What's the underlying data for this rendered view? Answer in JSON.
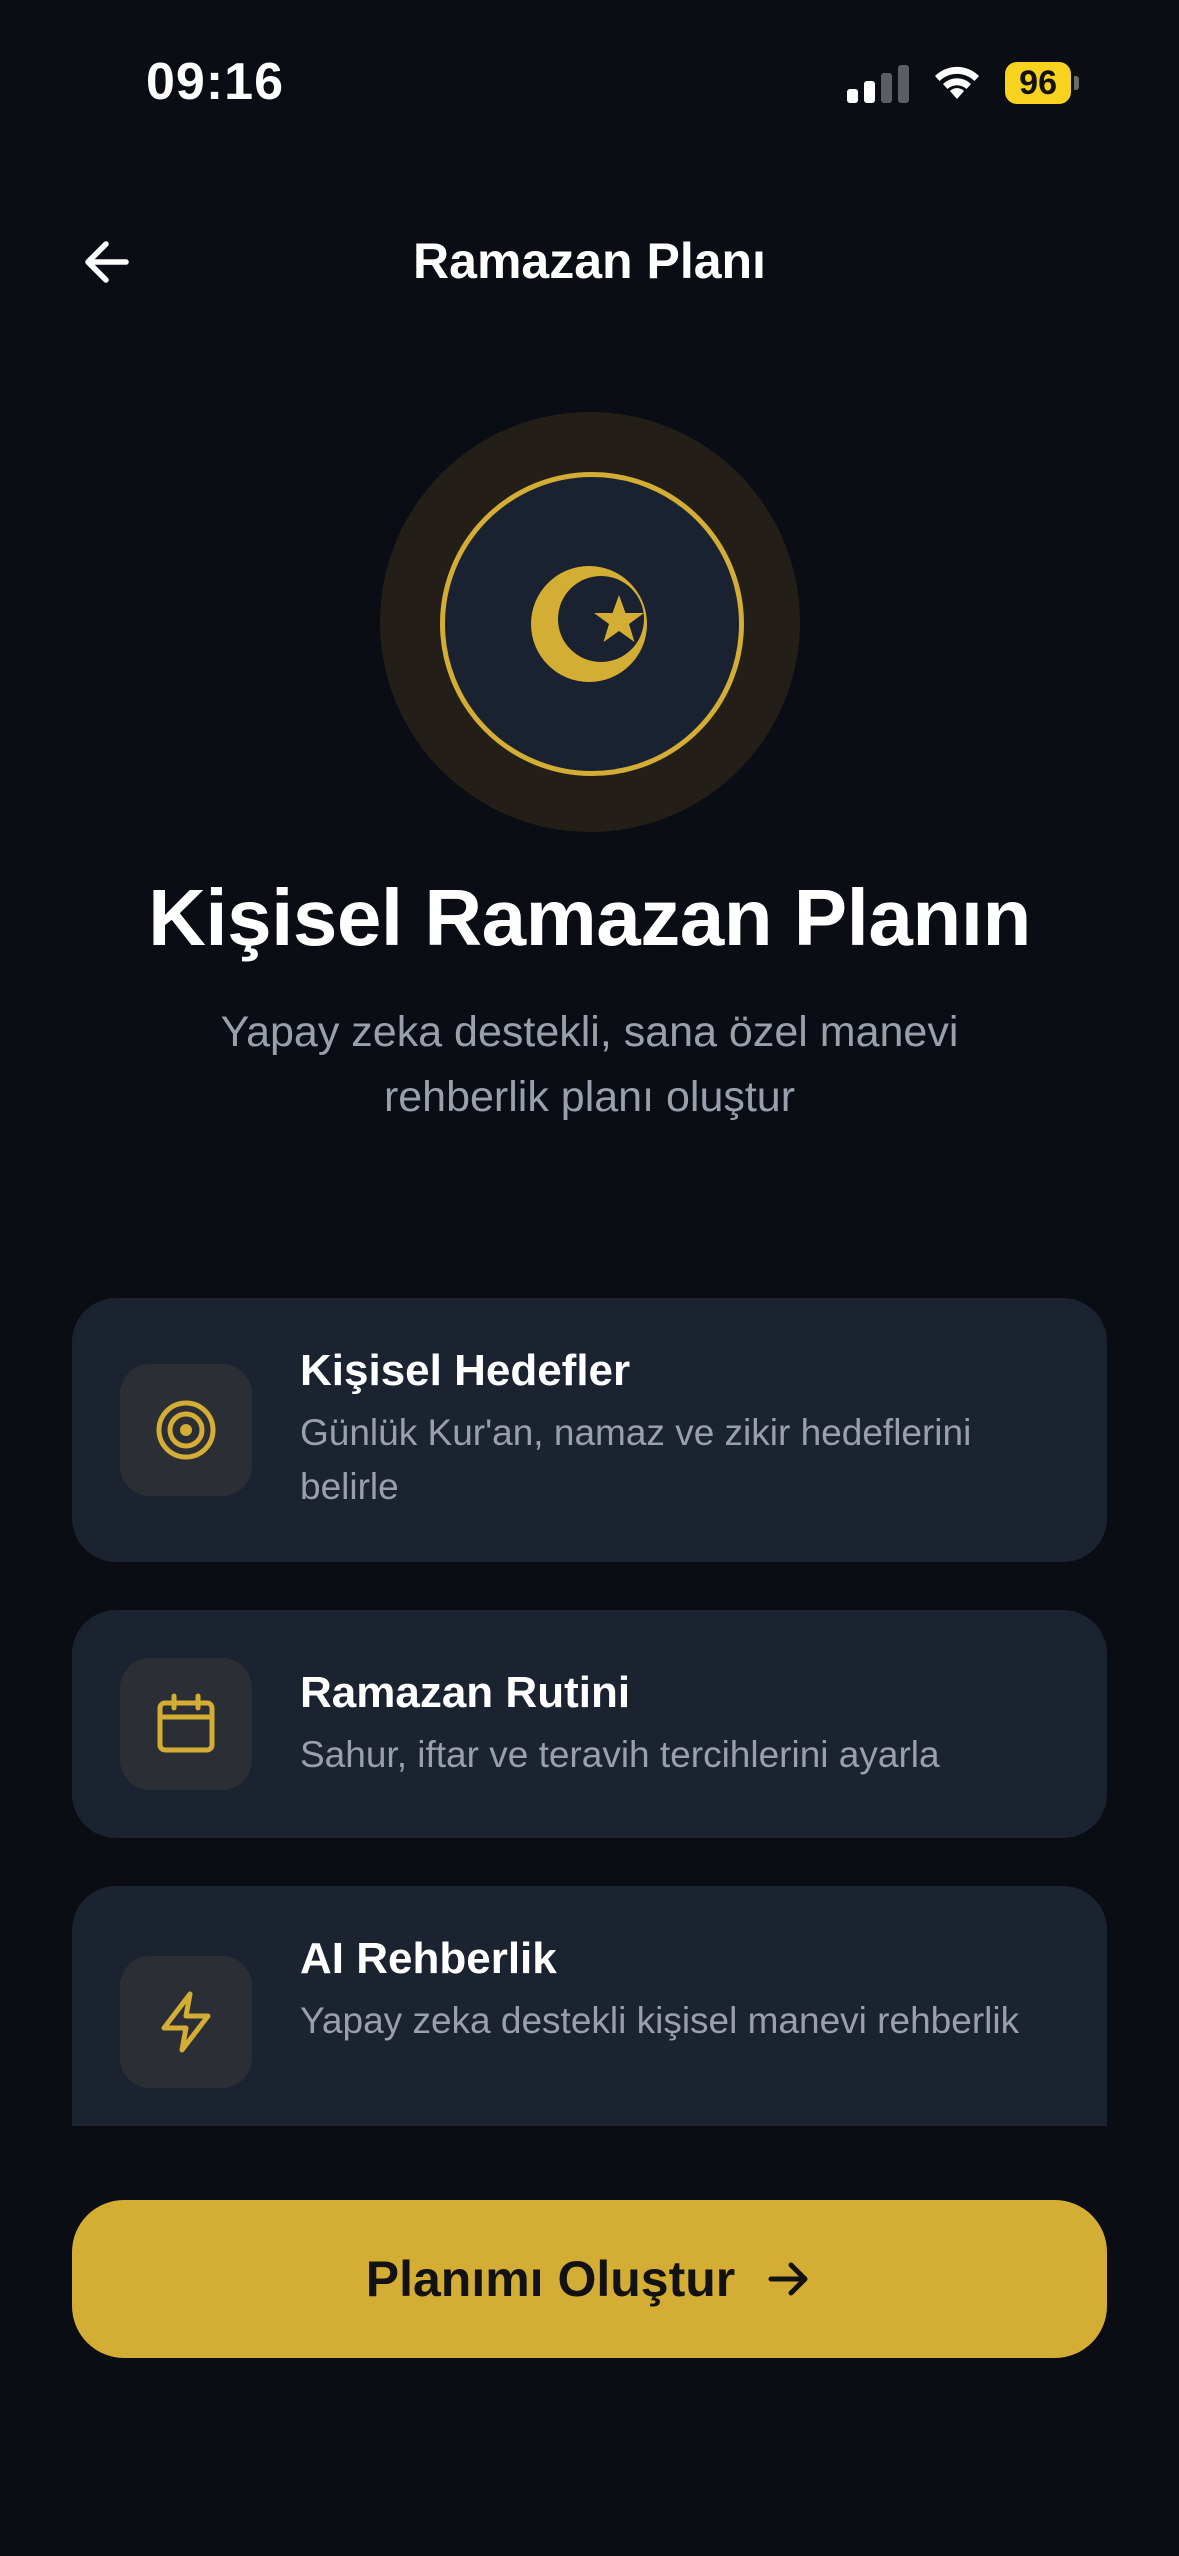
{
  "status_bar": {
    "time": "09:16",
    "battery": "96"
  },
  "nav": {
    "title": "Ramazan Planı"
  },
  "hero": {
    "title": "Kişisel Ramazan Planın",
    "subtitle": "Yapay zeka destekli, sana özel manevi rehberlik planı oluştur"
  },
  "features": [
    {
      "icon": "target-icon",
      "title": "Kişisel Hedefler",
      "description": "Günlük Kur'an, namaz ve zikir hedeflerini belirle"
    },
    {
      "icon": "calendar-icon",
      "title": "Ramazan Rutini",
      "description": "Sahur, iftar ve teravih tercihlerini ayarla"
    },
    {
      "icon": "lightning-icon",
      "title": "AI Rehberlik",
      "description": "Yapay zeka destekli kişisel manevi rehberlik"
    }
  ],
  "cta": {
    "label": "Planımı Oluştur"
  },
  "colors": {
    "background": "#0a0d14",
    "card": "#1b2230",
    "accent": "#d4ad35",
    "battery": "#f7d21f"
  }
}
